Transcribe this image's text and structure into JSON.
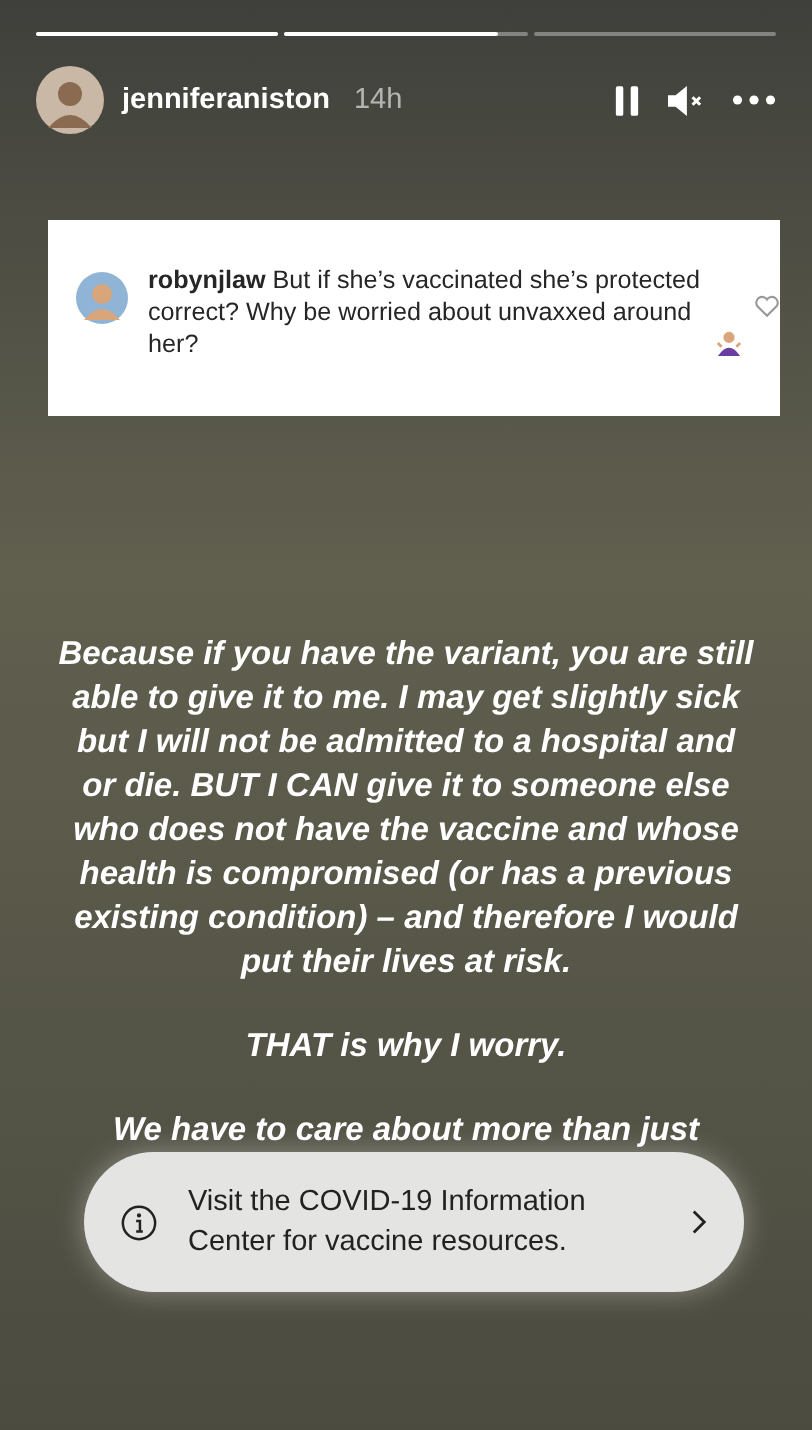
{
  "progress": [
    {
      "kind": "seen",
      "level": 1
    },
    {
      "kind": "playing",
      "level": 0.88
    },
    {
      "kind": "unseen"
    }
  ],
  "header": {
    "username": "jenniferaniston",
    "time": "14h",
    "paused": true,
    "muted": true
  },
  "comment": {
    "username": "robynjlaw",
    "text": "But if she’s vaccinated she’s protected correct? Why be worried about unvaxxed around her?",
    "liked": false
  },
  "paragraphs": [
    "Because if you have the variant, you are still able to give it to me. I may get slightly sick but I will not be admitted to a hospital and or die. BUT I CAN give it to someone else who does not have the vaccine and whose health is compromised (or has a previous existing condition) – and therefore I would put their lives at risk.",
    "THAT is why I worry.",
    "We have to care about more than just"
  ],
  "info_banner": {
    "text": "Visit the COVID-19 Information Center for vaccine resources."
  }
}
